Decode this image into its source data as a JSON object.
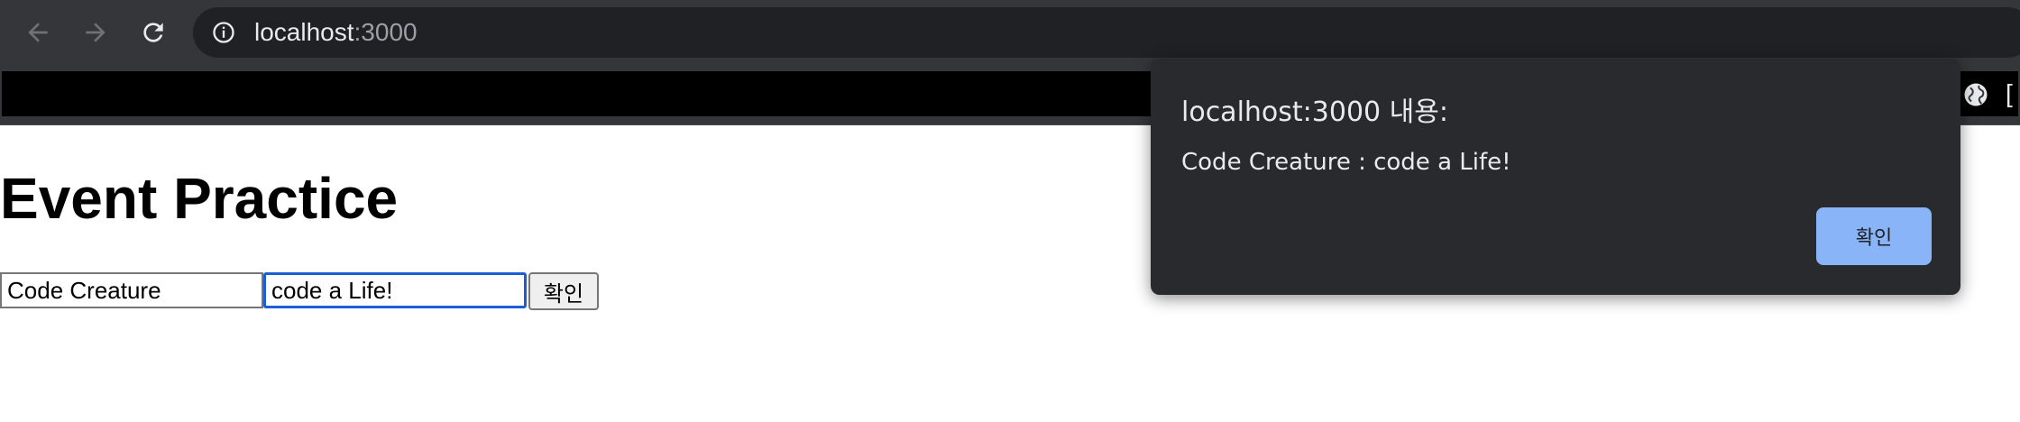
{
  "browser": {
    "url_host": "localhost",
    "url_port": ":3000",
    "bookmark_trunc": "[",
    "icons": {
      "back": "arrow-left-icon",
      "forward": "arrow-right-icon",
      "reload": "reload-icon",
      "site_info": "info-icon",
      "bookmark_globe": "globe-icon"
    }
  },
  "page": {
    "title": "Event Practice",
    "inputs": [
      {
        "value": "Code Creature"
      },
      {
        "value": "code a Life!"
      }
    ],
    "confirm_label": "확인"
  },
  "dialog": {
    "title": "localhost:3000 내용:",
    "message": "Code Creature : code a Life!",
    "ok_label": "확인"
  },
  "colors": {
    "chrome_bg": "#35363a",
    "omnibox_bg": "#202124",
    "dialog_bg": "#292a2d",
    "dialog_button": "#8ab4f8",
    "focus_ring": "#1a5fd8"
  }
}
